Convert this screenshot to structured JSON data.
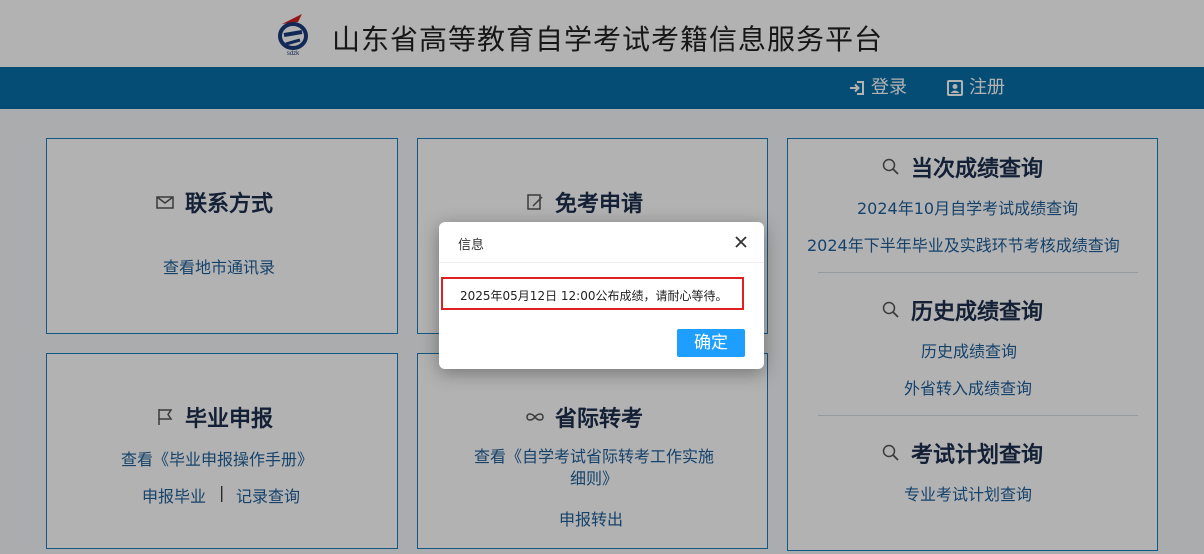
{
  "header": {
    "site_title": "山东省高等教育自学考试考籍信息服务平台",
    "logo_text": "sdzk"
  },
  "nav": {
    "login": "登录",
    "register": "注册"
  },
  "cards": {
    "contact": {
      "title": "联系方式",
      "link": "查看地市通讯录"
    },
    "exemption": {
      "title": "免考申请"
    },
    "graduation": {
      "title": "毕业申报",
      "manual": "查看《毕业申报操作手册》",
      "apply": "申报毕业",
      "divider": "|",
      "records": "记录查询"
    },
    "transfer": {
      "title": "省际转考",
      "rules": "查看《自学考试省际转考工作实施细则》",
      "apply": "申报转出"
    },
    "scores": {
      "current_title": "当次成绩查询",
      "current_links": [
        "2024年10月自学考试成绩查询",
        "2024年下半年毕业及实践环节考核成绩查询"
      ],
      "history_title": "历史成绩查询",
      "history_links": [
        "历史成绩查询",
        "外省转入成绩查询"
      ],
      "plan_title": "考试计划查询",
      "plan_links": [
        "专业考试计划查询"
      ]
    }
  },
  "dialog": {
    "title": "信息",
    "message": "2025年05月12日 12:00公布成绩，请耐心等待。",
    "ok": "确定"
  },
  "colors": {
    "nav_bg": "#0a6fa8",
    "card_border": "#1a7fbf",
    "ok_button": "#1e9fff",
    "highlight": "#e02020"
  }
}
